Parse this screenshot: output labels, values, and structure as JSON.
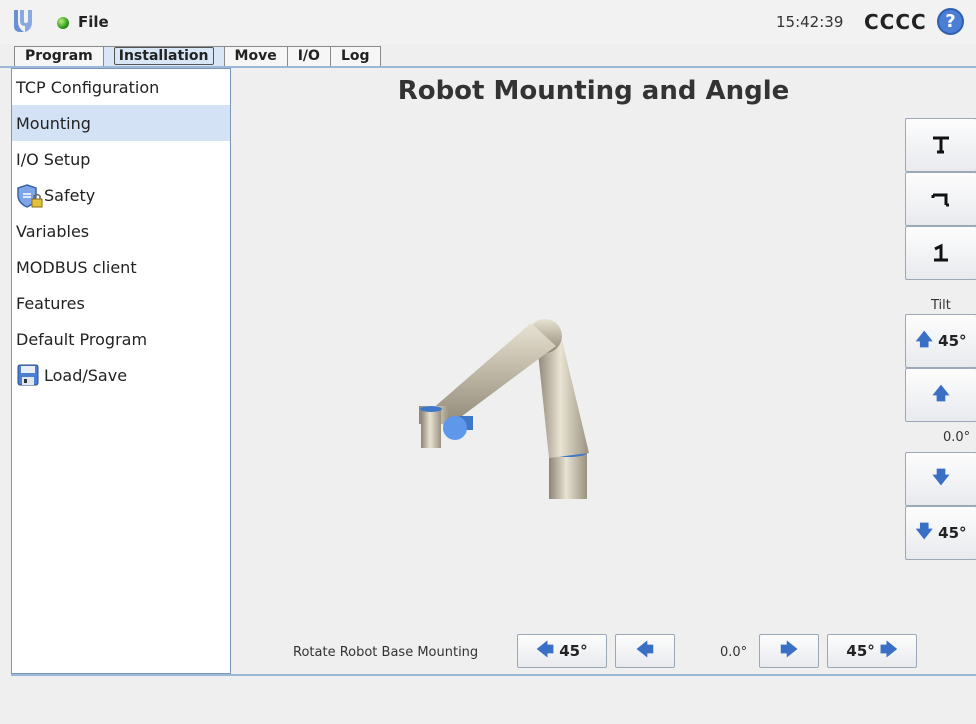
{
  "topbar": {
    "file_label": "File",
    "clock": "15:42:39",
    "robot_name": "CCCC",
    "help_glyph": "?"
  },
  "tabs": [
    {
      "label": "Program",
      "active": false
    },
    {
      "label": "Installation",
      "active": true
    },
    {
      "label": "Move",
      "active": false
    },
    {
      "label": "I/O",
      "active": false
    },
    {
      "label": "Log",
      "active": false
    }
  ],
  "sidebar": {
    "items": [
      {
        "label": "TCP Configuration",
        "icon": null,
        "selected": false
      },
      {
        "label": "Mounting",
        "icon": null,
        "selected": true
      },
      {
        "label": "I/O Setup",
        "icon": null,
        "selected": false
      },
      {
        "label": "Safety",
        "icon": "shield-lock-icon",
        "selected": false
      },
      {
        "label": "Variables",
        "icon": null,
        "selected": false
      },
      {
        "label": "MODBUS client",
        "icon": null,
        "selected": false
      },
      {
        "label": "Features",
        "icon": null,
        "selected": false
      },
      {
        "label": "Default Program",
        "icon": null,
        "selected": false
      },
      {
        "label": "Load/Save",
        "icon": "floppy-disk-icon",
        "selected": false
      }
    ]
  },
  "main": {
    "title": "Robot Mounting and Angle",
    "tilt": {
      "label": "Tilt",
      "up45": "45°",
      "down45": "45°",
      "value": "0.0°"
    },
    "rotate": {
      "label": "Rotate Robot Base Mounting",
      "left45": "45°",
      "right45": "45°",
      "value": "0.0°"
    }
  },
  "colors": {
    "accent": "#3a6fc6",
    "selection": "#d3e2f5",
    "border": "#7b96b6"
  }
}
